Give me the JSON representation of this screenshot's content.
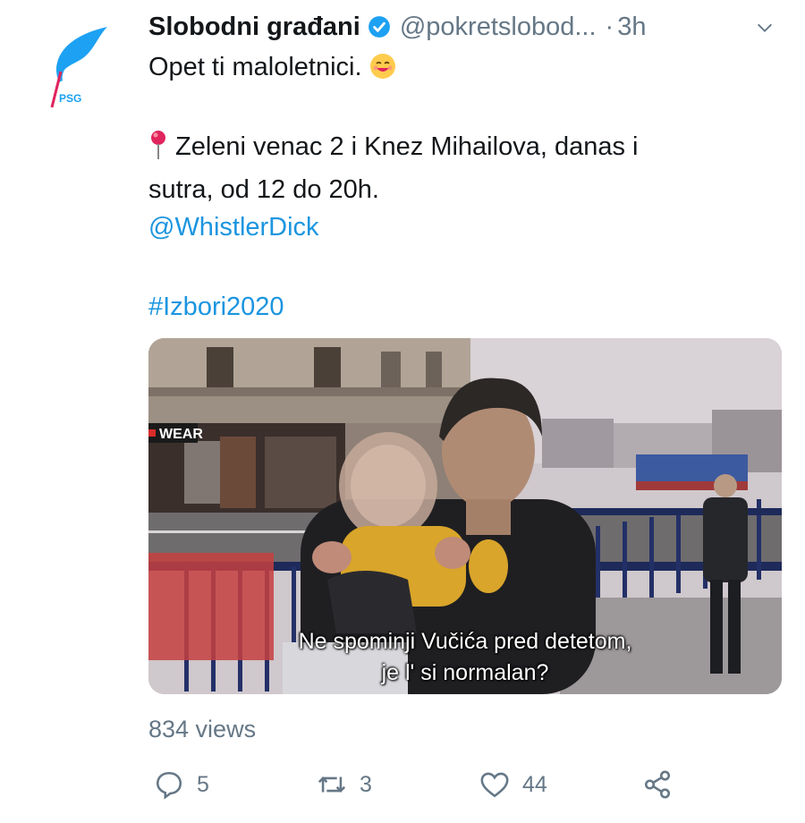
{
  "author": {
    "name": "Slobodni građani",
    "handle": "@pokretslobod...",
    "separator": "·",
    "time": "3h",
    "avatar_text": "PSG"
  },
  "tweet": {
    "line1": "Opet ti maloletnici.",
    "line2": "Zeleni venac 2 i Knez Mihailova, danas i",
    "line3": "sutra, od 12 do 20h.",
    "mention": "@WhistlerDick",
    "hashtag": "#Izbori2020"
  },
  "media": {
    "subtitle_line1": "Ne spominji Vučića pred detetom,",
    "subtitle_line2": "je l' si normalan?",
    "sign_text": "WEAR"
  },
  "stats": {
    "views": "834 views",
    "replies": "5",
    "retweets": "3",
    "likes": "44"
  },
  "icons": [
    "verified-icon",
    "chevron-down-icon",
    "smiling-emoji-icon",
    "pin-icon",
    "reply-icon",
    "retweet-icon",
    "like-icon",
    "share-icon"
  ],
  "colors": {
    "accent": "#1da1f2",
    "link": "#1b95e0",
    "muted": "#657786"
  }
}
